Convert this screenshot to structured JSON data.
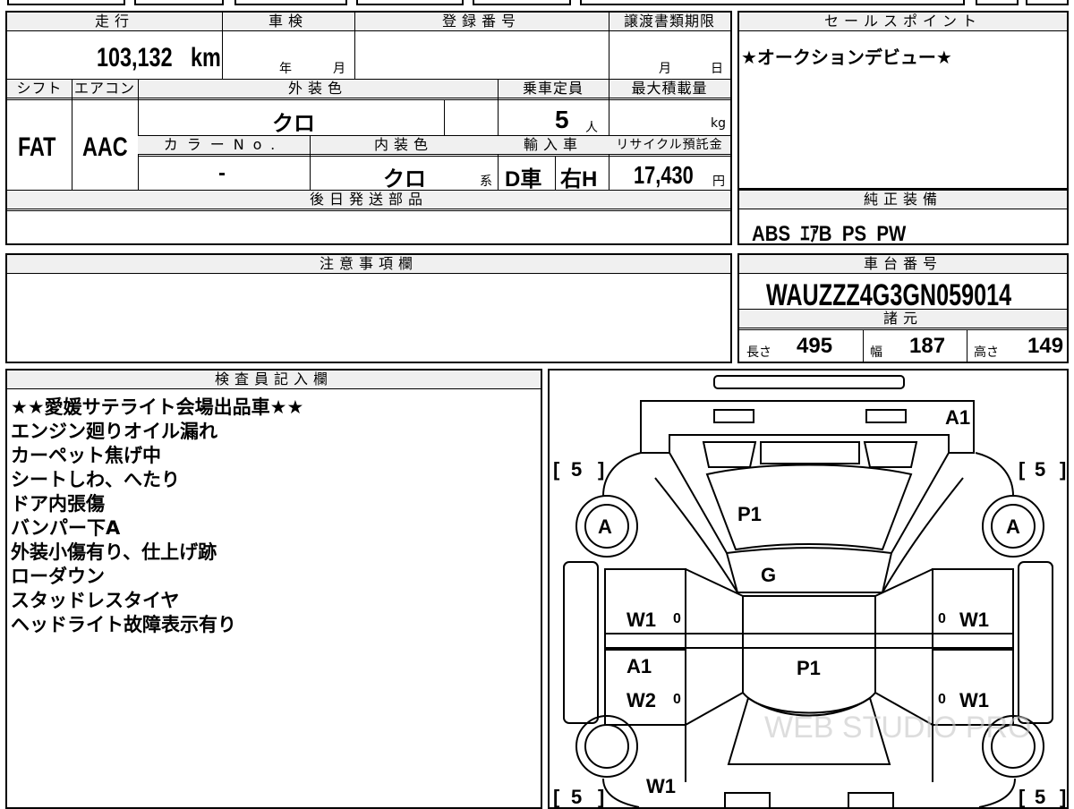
{
  "top_row": {
    "fragment": "…"
  },
  "mileage": {
    "label": "走行",
    "value": "103,132",
    "unit": "km"
  },
  "inspection": {
    "label": "車検",
    "year_unit": "年",
    "month_unit": "月"
  },
  "registration": {
    "label": "登録番号",
    "value": ""
  },
  "transfer_deadline": {
    "label": "譲渡書類期限",
    "month_unit": "月",
    "day_unit": "日"
  },
  "sales_point": {
    "label": "セールスポイント",
    "text": "★オークションデビュー★"
  },
  "shift": {
    "label": "シフト",
    "value": "FAT"
  },
  "aircon": {
    "label": "エアコン",
    "value": "AAC"
  },
  "exterior_color": {
    "label": "外装色",
    "value": "クロ"
  },
  "capacity": {
    "label": "乗車定員",
    "value": "5",
    "unit": "人"
  },
  "max_load": {
    "label": "最大積載量",
    "unit": "kg"
  },
  "color_no": {
    "label": "カラーNo.",
    "value": "-"
  },
  "interior_color": {
    "label": "内装色",
    "value": "クロ",
    "suffix": "系"
  },
  "import": {
    "label": "輸入車",
    "dealer": "D車",
    "steering": "右H"
  },
  "recycle": {
    "label": "リサイクル預託金",
    "value": "17,430",
    "unit": "円"
  },
  "later_parts": {
    "label": "後日発送部品",
    "text": ""
  },
  "equipment": {
    "label": "純正装備",
    "text": "ABS  ｴｱB  PS  PW"
  },
  "notes_field": {
    "label": "注意事項欄",
    "text": ""
  },
  "chassis": {
    "label": "車台番号",
    "value": "WAUZZZ4G3GN059014"
  },
  "specs": {
    "label": "諸元",
    "length_label": "長さ",
    "length": "495",
    "width_label": "幅",
    "width": "187",
    "height_label": "高さ",
    "height": "149"
  },
  "inspector": {
    "label": "検査員記入欄",
    "lines": [
      "★★愛媛サテライト会場出品車★★",
      "エンジン廻りオイル漏れ",
      "カーペット焦げ中",
      "シートしわ、へたり",
      "ドア内張傷",
      "バンパー下A",
      "外装小傷有り、仕上げ跡",
      "ローダウン",
      "スタッドレスタイヤ",
      "ヘッドライト故障表示有り"
    ]
  },
  "diagram": {
    "marks": {
      "front": "A1",
      "hood": "P1",
      "windshield": "G",
      "roof": "P1",
      "left_front_door": "W1",
      "left_rear_door_a": "A1",
      "left_rear_door_w": "W2",
      "right_front_door": "W1",
      "right_rear_door": "W1",
      "rear_left": "W1",
      "wheel_front_left": "A",
      "wheel_front_right": "A"
    },
    "tread": {
      "front_left": "5",
      "front_right": "5",
      "rear_left": "5",
      "rear_right": "5"
    },
    "zero": "0",
    "bracket_open": "[",
    "bracket_close": "]",
    "watermark": "WEB STUDIO PRO"
  }
}
